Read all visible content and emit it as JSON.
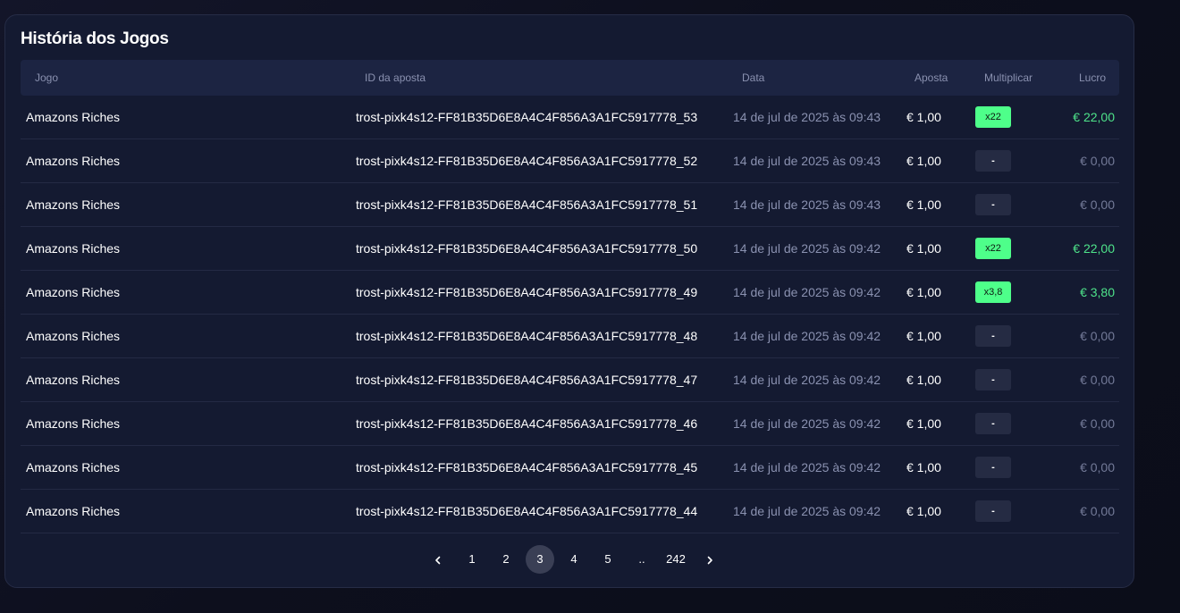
{
  "panel": {
    "title": "História dos Jogos"
  },
  "table": {
    "columns": {
      "game": "Jogo",
      "bet_id": "ID da aposta",
      "date": "Data",
      "bet": "Aposta",
      "multiplier": "Multiplicar",
      "profit": "Lucro"
    },
    "rows": [
      {
        "game": "Amazons Riches",
        "bet_id": "trost-pixk4s12-FF81B35D6E8A4C4F856A3A1FC5917778_53",
        "date": "14 de jul de 2025 às 09:43",
        "bet": "€ 1,00",
        "multiplier": "x22",
        "profit": "€ 22,00",
        "win": true
      },
      {
        "game": "Amazons Riches",
        "bet_id": "trost-pixk4s12-FF81B35D6E8A4C4F856A3A1FC5917778_52",
        "date": "14 de jul de 2025 às 09:43",
        "bet": "€ 1,00",
        "multiplier": "-",
        "profit": "€ 0,00",
        "win": false
      },
      {
        "game": "Amazons Riches",
        "bet_id": "trost-pixk4s12-FF81B35D6E8A4C4F856A3A1FC5917778_51",
        "date": "14 de jul de 2025 às 09:43",
        "bet": "€ 1,00",
        "multiplier": "-",
        "profit": "€ 0,00",
        "win": false
      },
      {
        "game": "Amazons Riches",
        "bet_id": "trost-pixk4s12-FF81B35D6E8A4C4F856A3A1FC5917778_50",
        "date": "14 de jul de 2025 às 09:42",
        "bet": "€ 1,00",
        "multiplier": "x22",
        "profit": "€ 22,00",
        "win": true
      },
      {
        "game": "Amazons Riches",
        "bet_id": "trost-pixk4s12-FF81B35D6E8A4C4F856A3A1FC5917778_49",
        "date": "14 de jul de 2025 às 09:42",
        "bet": "€ 1,00",
        "multiplier": "x3,8",
        "profit": "€ 3,80",
        "win": true
      },
      {
        "game": "Amazons Riches",
        "bet_id": "trost-pixk4s12-FF81B35D6E8A4C4F856A3A1FC5917778_48",
        "date": "14 de jul de 2025 às 09:42",
        "bet": "€ 1,00",
        "multiplier": "-",
        "profit": "€ 0,00",
        "win": false
      },
      {
        "game": "Amazons Riches",
        "bet_id": "trost-pixk4s12-FF81B35D6E8A4C4F856A3A1FC5917778_47",
        "date": "14 de jul de 2025 às 09:42",
        "bet": "€ 1,00",
        "multiplier": "-",
        "profit": "€ 0,00",
        "win": false
      },
      {
        "game": "Amazons Riches",
        "bet_id": "trost-pixk4s12-FF81B35D6E8A4C4F856A3A1FC5917778_46",
        "date": "14 de jul de 2025 às 09:42",
        "bet": "€ 1,00",
        "multiplier": "-",
        "profit": "€ 0,00",
        "win": false
      },
      {
        "game": "Amazons Riches",
        "bet_id": "trost-pixk4s12-FF81B35D6E8A4C4F856A3A1FC5917778_45",
        "date": "14 de jul de 2025 às 09:42",
        "bet": "€ 1,00",
        "multiplier": "-",
        "profit": "€ 0,00",
        "win": false
      },
      {
        "game": "Amazons Riches",
        "bet_id": "trost-pixk4s12-FF81B35D6E8A4C4F856A3A1FC5917778_44",
        "date": "14 de jul de 2025 às 09:42",
        "bet": "€ 1,00",
        "multiplier": "-",
        "profit": "€ 0,00",
        "win": false
      }
    ]
  },
  "pagination": {
    "pages": [
      "1",
      "2",
      "3",
      "4",
      "5",
      "..",
      "242"
    ],
    "current": "3",
    "prev_icon": "chevron-left-icon",
    "next_icon": "chevron-right-icon"
  },
  "colors": {
    "win_badge": "#4eff8a",
    "win_text": "#4ee38a",
    "panel_bg": "#141a31"
  }
}
